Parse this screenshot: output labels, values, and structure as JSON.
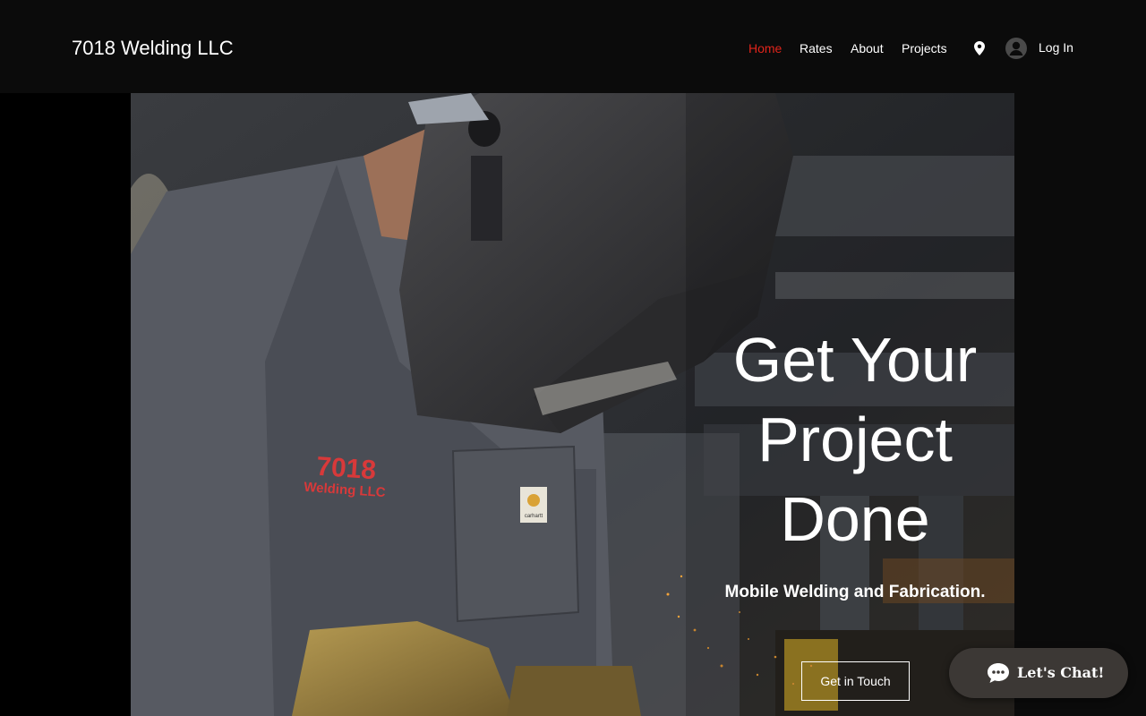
{
  "header": {
    "site_title": "7018 Welding LLC",
    "nav": [
      {
        "label": "Home",
        "active": true
      },
      {
        "label": "Rates",
        "active": false
      },
      {
        "label": "About",
        "active": false
      },
      {
        "label": "Projects",
        "active": false
      }
    ],
    "location_icon": "map-pin-icon",
    "avatar_icon": "user-avatar-icon",
    "login_label": "Log In"
  },
  "hero": {
    "headline": [
      "Get Your",
      "Project",
      "Done"
    ],
    "subheadline": "Mobile Welding and Fabrication.",
    "cta_label": "Get in Touch",
    "shirt_logo_line1": "7018",
    "shirt_logo_line2": "Welding LLC",
    "pocket_tag": "carhartt"
  },
  "chat_widget": {
    "label": "Let's Chat!",
    "icon": "chat-bubble-icon"
  },
  "colors": {
    "header_bg": "#0b0b0b",
    "nav_active": "#e0241b",
    "nav_text": "#ffffff",
    "chat_bg": "#3c3835"
  }
}
